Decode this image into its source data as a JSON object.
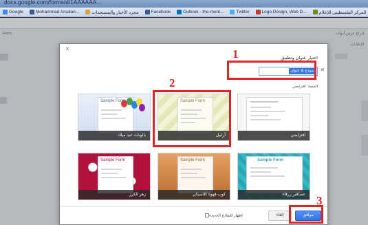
{
  "browser": {
    "url": "docs.google.com/forms/d/1AAAAAA...",
    "bookmarks": [
      {
        "label": "Google",
        "color": "#4285f4",
        "icon": "google-icon"
      },
      {
        "label": "Mohammad Arsalan...",
        "color": "#3b5998",
        "icon": "profile-icon"
      },
      {
        "label": "مجرد الأخبار والمستجدات",
        "color": "#d9a441",
        "icon": "news-icon"
      },
      {
        "label": "Facebook",
        "color": "#3b5998",
        "icon": "facebook-icon"
      },
      {
        "label": "Outlook - the-mont...",
        "color": "#0072c6",
        "icon": "outlook-icon"
      },
      {
        "label": "Twitter",
        "color": "#55acee",
        "icon": "twitter-icon"
      },
      {
        "label": "Logo Design, Web D...",
        "color": "#c0392b",
        "icon": "logo-icon"
      },
      {
        "label": "المركز الفلسطيني للإعلام",
        "color": "#6b8e23",
        "icon": "palestine-center-icon"
      }
    ]
  },
  "background_page": {
    "left_menu": "Form",
    "right_menu": "إدراج  عرض  أدوات",
    "right_menu2": "الإعلانات"
  },
  "dialog": {
    "title": "اختيار عنوان وتطبيق",
    "name_label": "الا",
    "name_value": "نموذج بلا عنوان",
    "theme_label": "السمة: افتراضي",
    "themes": [
      {
        "key": "balloons",
        "caption": "بالونات عيد ميلاد",
        "sample": "Sample Form"
      },
      {
        "key": "arabesque",
        "caption": "أرابيل",
        "sample": "Sample Form"
      },
      {
        "key": "default",
        "caption": "افتراضي",
        "sample": ""
      },
      {
        "key": "pink",
        "caption": "زهر الكرز",
        "sample": "Sample Form"
      },
      {
        "key": "coffee",
        "caption": "كوب قهوة كلاسيكي",
        "sample": "Sample Form"
      },
      {
        "key": "teal",
        "caption": "عصافير زرقاء",
        "sample": "Sample Form"
      }
    ],
    "show_checkbox_label": "إظهار للنماذج الجديدة",
    "cancel_label": "إلغاء",
    "ok_label": "موافق"
  },
  "annotations": {
    "step1": "1",
    "step2": "2",
    "step3": "3",
    "color": "#e02424"
  }
}
